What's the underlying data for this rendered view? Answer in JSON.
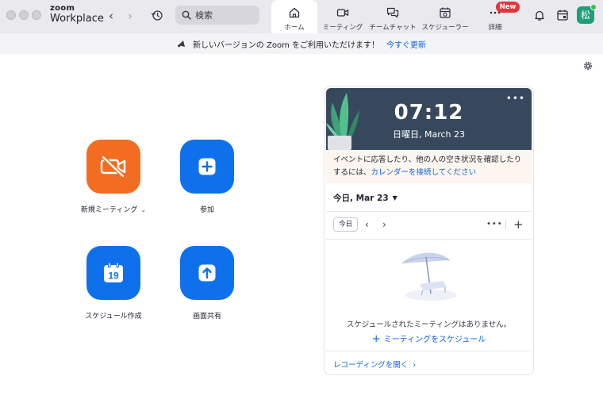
{
  "app": {
    "brand_small": "zoom",
    "brand_name": "Workplace"
  },
  "search": {
    "placeholder": "検索"
  },
  "tabs": [
    {
      "label": "ホーム",
      "icon": "home-icon",
      "active": true
    },
    {
      "label": "ミーティング",
      "icon": "video-icon",
      "active": false
    },
    {
      "label": "チームチャット",
      "icon": "chat-icon",
      "active": false
    },
    {
      "label": "スケジューラー",
      "icon": "scheduler-icon",
      "active": false
    },
    {
      "label": "詳細",
      "icon": "more-icon",
      "active": false,
      "badge": "New"
    }
  ],
  "user": {
    "avatar_text": "松",
    "status_color": "#2fc74c"
  },
  "banner": {
    "text": "新しいバージョンの Zoom をご利用いただけます！",
    "link": "今すぐ更新"
  },
  "actions": [
    {
      "label": "新規ミーティング",
      "icon": "video-off-icon",
      "color": "#f26d21",
      "has_menu": true
    },
    {
      "label": "参加",
      "icon": "plus-icon",
      "color": "#0e71eb"
    },
    {
      "label": "スケジュール作成",
      "icon": "calendar-icon",
      "color": "#0e71eb",
      "icon_text": "19"
    },
    {
      "label": "画面共有",
      "icon": "share-up-arrow-icon",
      "color": "#0e71eb"
    }
  ],
  "calendar": {
    "time": "07:12",
    "date": "日曜日, March 23",
    "notice_text": "イベントに応答したり、他の人の空き状況を確認したりするには、",
    "notice_link": "カレンダーを接続してください",
    "day_label": "今日, Mar 23",
    "today_button": "今日",
    "empty_text": "スケジュールされたミーティングはありません。",
    "schedule_link": "ミーティングをスケジュール",
    "recordings_link": "レコーディングを開く"
  },
  "colors": {
    "accent": "#0e71eb",
    "link": "#0e63d6",
    "orange": "#f26d21",
    "hero_bg": "#38485c",
    "badge": "#e8333b"
  }
}
